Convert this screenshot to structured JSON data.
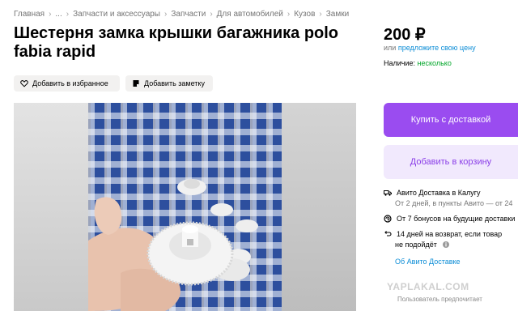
{
  "breadcrumb": [
    "Главная",
    "...",
    "Запчасти и аксессуары",
    "Запчасти",
    "Для автомобилей",
    "Кузов",
    "Замки"
  ],
  "title": "Шестерня замка крышки багажника polo fabia rapid",
  "price": {
    "value": "200 ₽",
    "or_text": "или",
    "suggest_link": "предложите свою цену"
  },
  "availability": {
    "label": "Наличие:",
    "value": "несколько"
  },
  "actions": {
    "favorite": "Добавить в избранное",
    "note": "Добавить заметку"
  },
  "buttons": {
    "buy": "Купить с доставкой",
    "cart": "Добавить в корзину"
  },
  "delivery": {
    "title": "Авито Доставка в Калугу",
    "subtitle": "От 2 дней, в пункты Авито — от 24",
    "bonus": "От 7 бонусов на будущие доставки",
    "return_line1": "14 дней на возврат, если товар",
    "return_line2": "не подойдёт",
    "about_link": "Об Авито Доставке"
  },
  "watermark": "YAPLAKAL.COM",
  "footer_note": "Пользователь предпочитает",
  "colors": {
    "accent": "#9a4cf0",
    "accent_light": "#f1e9fd",
    "link": "#0a8cd6",
    "green": "#02a629"
  }
}
